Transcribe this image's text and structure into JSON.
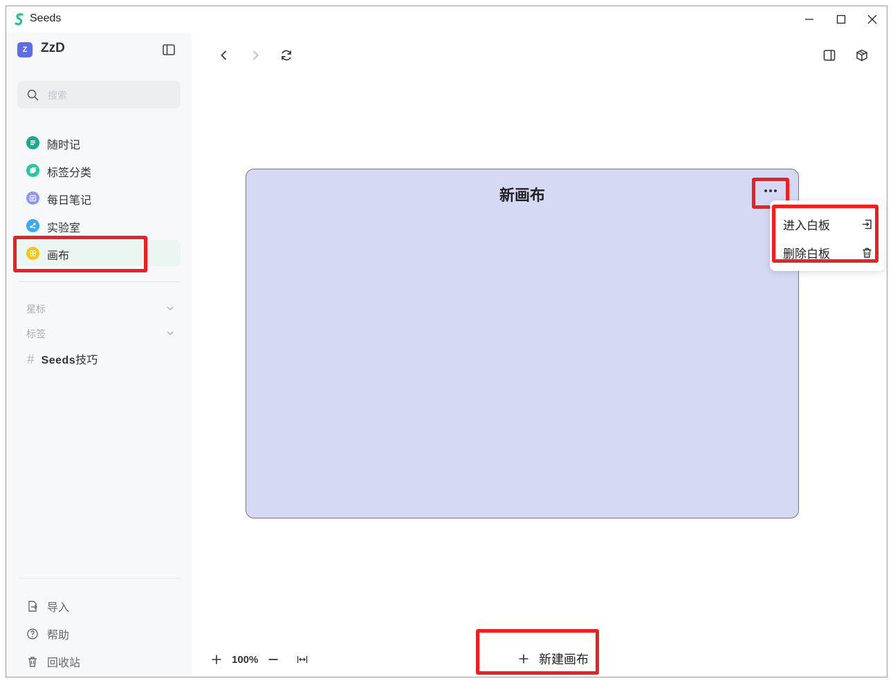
{
  "window": {
    "title": "Seeds"
  },
  "workspace": {
    "avatar": "Z",
    "name": "ZzD"
  },
  "search": {
    "placeholder": "搜索"
  },
  "nav": [
    {
      "label": "随时记",
      "icon": "note-icon",
      "color": "#1aa98a"
    },
    {
      "label": "标签分类",
      "icon": "tags-icon",
      "color": "#25c9a1"
    },
    {
      "label": "每日笔记",
      "icon": "daily-note-icon",
      "color": "#8e97ee"
    },
    {
      "label": "实验室",
      "icon": "lab-icon",
      "color": "#3ba9f0"
    },
    {
      "label": "画布",
      "icon": "canvas-icon",
      "color": "#f5c518",
      "active": true
    }
  ],
  "sections": {
    "starred": "星标",
    "tags": "标签"
  },
  "tag_items": [
    {
      "hash": "#",
      "bold": "Seeds",
      "rest": "技巧"
    }
  ],
  "footer": {
    "import": "导入",
    "help": "帮助",
    "trash": "回收站"
  },
  "canvas_board": {
    "title": "新画布"
  },
  "context_menu": {
    "enter": "进入白板",
    "delete": "删除白板"
  },
  "zoom": {
    "value": "100%"
  },
  "new_canvas_label": "新建画布",
  "colors": {
    "board_bg": "#d6d9f4",
    "highlight": "#f01e1e",
    "active_nav_bg": "#ebf5f1"
  }
}
